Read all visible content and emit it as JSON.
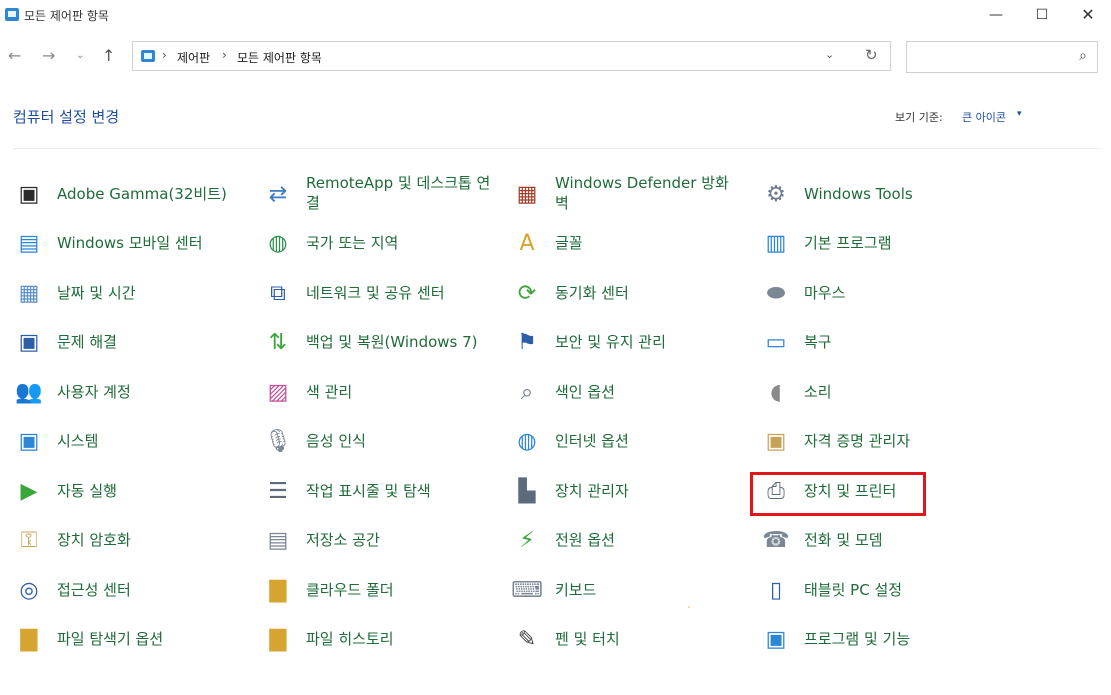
{
  "window": {
    "title": "모든 제어판 항목",
    "minimize": "—",
    "maximize": "☐",
    "close": "✕"
  },
  "nav": {
    "back": "←",
    "forward": "→",
    "recent": "⌄",
    "up": "↑",
    "breadcrumb": [
      "제어판",
      "모든 제어판 항목"
    ],
    "separator": "›",
    "dropdown": "⌄",
    "refresh": "↻",
    "search_placeholder": "",
    "search_icon": "⌕"
  },
  "header": {
    "title": "컴퓨터 설정 변경",
    "view_by_label": "보기 기준:",
    "view_by_value": "큰 아이콘",
    "caret": "▾"
  },
  "items": [
    {
      "label": "Adobe Gamma(32비트)",
      "icon": "monitor-icon",
      "glyph": "▣",
      "color": "#2a2a2a"
    },
    {
      "label": "RemoteApp 및 데스크톱 연결",
      "icon": "remote-desktop-icon",
      "glyph": "⇄",
      "color": "#3b7bbf"
    },
    {
      "label": "Windows Defender 방화벽",
      "icon": "firewall-icon",
      "glyph": "▦",
      "color": "#a0402a"
    },
    {
      "label": "Windows Tools",
      "icon": "gear-icon",
      "glyph": "⚙",
      "color": "#6b7b8c"
    },
    {
      "label": "Windows 모바일 센터",
      "icon": "mobility-center-icon",
      "glyph": "▤",
      "color": "#2d86d6"
    },
    {
      "label": "국가 또는 지역",
      "icon": "globe-clock-icon",
      "glyph": "◍",
      "color": "#2f8f4a"
    },
    {
      "label": "글꼴",
      "icon": "font-folder-icon",
      "glyph": "A",
      "color": "#d6a430"
    },
    {
      "label": "기본 프로그램",
      "icon": "default-programs-icon",
      "glyph": "▥",
      "color": "#2d86d6"
    },
    {
      "label": "날짜 및 시간",
      "icon": "calendar-icon",
      "glyph": "▦",
      "color": "#5b8fc7"
    },
    {
      "label": "네트워크 및 공유 센터",
      "icon": "network-icon",
      "glyph": "⧉",
      "color": "#2d5fa8"
    },
    {
      "label": "동기화 센터",
      "icon": "sync-icon",
      "glyph": "⟳",
      "color": "#3aa63a"
    },
    {
      "label": "마우스",
      "icon": "mouse-icon",
      "glyph": "⬬",
      "color": "#7b8794"
    },
    {
      "label": "문제 해결",
      "icon": "troubleshoot-icon",
      "glyph": "▣",
      "color": "#2d5fa8"
    },
    {
      "label": "백업 및 복원(Windows 7)",
      "icon": "backup-icon",
      "glyph": "⇅",
      "color": "#3aa63a"
    },
    {
      "label": "보안 및 유지 관리",
      "icon": "flag-icon",
      "glyph": "⚑",
      "color": "#2d5fa8"
    },
    {
      "label": "복구",
      "icon": "recovery-icon",
      "glyph": "▭",
      "color": "#2d86d6"
    },
    {
      "label": "사용자 계정",
      "icon": "user-accounts-icon",
      "glyph": "👥",
      "color": "#3a7a3a"
    },
    {
      "label": "색 관리",
      "icon": "color-management-icon",
      "glyph": "▨",
      "color": "#c0509a"
    },
    {
      "label": "색인 옵션",
      "icon": "indexing-icon",
      "glyph": "⌕",
      "color": "#6b7b8c"
    },
    {
      "label": "소리",
      "icon": "speaker-icon",
      "glyph": "◖",
      "color": "#8a8a8a"
    },
    {
      "label": "시스템",
      "icon": "system-icon",
      "glyph": "▣",
      "color": "#2d86d6"
    },
    {
      "label": "음성 인식",
      "icon": "microphone-icon",
      "glyph": "🎙",
      "color": "#7b8794"
    },
    {
      "label": "인터넷 옵션",
      "icon": "internet-options-icon",
      "glyph": "◍",
      "color": "#2d86d6"
    },
    {
      "label": "자격 증명 관리자",
      "icon": "credential-vault-icon",
      "glyph": "▣",
      "color": "#c7a35a"
    },
    {
      "label": "자동 실행",
      "icon": "autoplay-icon",
      "glyph": "▶",
      "color": "#3aa63a"
    },
    {
      "label": "작업 표시줄 및 탐색",
      "icon": "taskbar-icon",
      "glyph": "☰",
      "color": "#5b6b7c"
    },
    {
      "label": "장치 관리자",
      "icon": "device-manager-icon",
      "glyph": "▙",
      "color": "#5b6b7c"
    },
    {
      "label": "장치 및 프린터",
      "icon": "printer-icon",
      "glyph": "⎙",
      "color": "#5b6b7c"
    },
    {
      "label": "장치 암호화",
      "icon": "device-encryption-icon",
      "glyph": "⚿",
      "color": "#c7a35a"
    },
    {
      "label": "저장소 공간",
      "icon": "storage-spaces-icon",
      "glyph": "▤",
      "color": "#7b8794"
    },
    {
      "label": "전원 옵션",
      "icon": "power-options-icon",
      "glyph": "⚡",
      "color": "#3aa63a"
    },
    {
      "label": "전화 및 모뎀",
      "icon": "phone-modem-icon",
      "glyph": "☎",
      "color": "#7b8794"
    },
    {
      "label": "접근성 센터",
      "icon": "ease-of-access-icon",
      "glyph": "◎",
      "color": "#2d5fa8"
    },
    {
      "label": "클라우드 폴더",
      "icon": "cloud-folder-icon",
      "glyph": "▇",
      "color": "#d6a430"
    },
    {
      "label": "키보드",
      "icon": "keyboard-icon",
      "glyph": "⌨",
      "color": "#7b8794"
    },
    {
      "label": "태블릿 PC 설정",
      "icon": "tablet-icon",
      "glyph": "▯",
      "color": "#2d5fa8"
    },
    {
      "label": "파일 탐색기 옵션",
      "icon": "folder-options-icon",
      "glyph": "▇",
      "color": "#d6a430"
    },
    {
      "label": "파일 히스토리",
      "icon": "file-history-icon",
      "glyph": "▇",
      "color": "#d6a430"
    },
    {
      "label": "펜 및 터치",
      "icon": "pen-icon",
      "glyph": "✎",
      "color": "#444444"
    },
    {
      "label": "프로그램 및 기능",
      "icon": "programs-features-icon",
      "glyph": "▣",
      "color": "#2d86d6"
    }
  ],
  "two_line": [
    1,
    2
  ]
}
